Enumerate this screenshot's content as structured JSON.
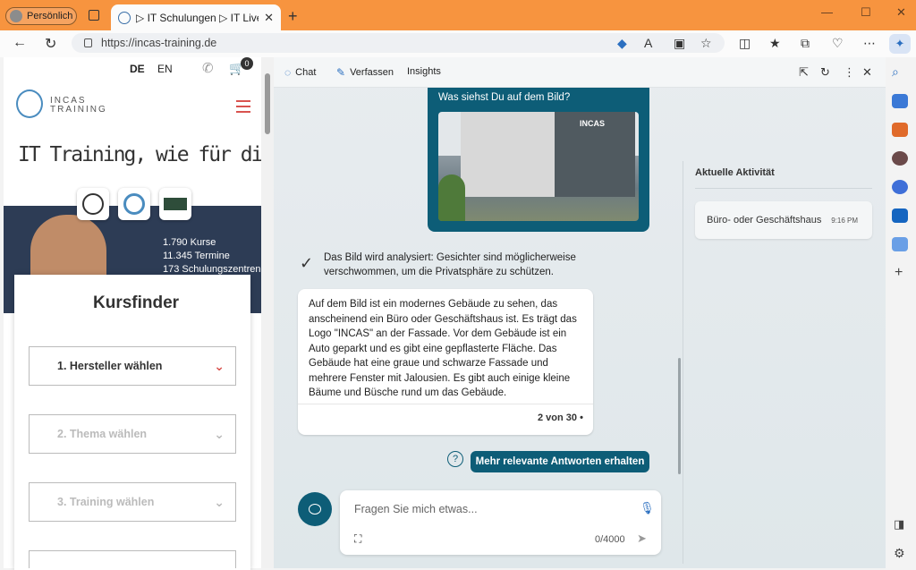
{
  "browser": {
    "profile": "Persönlich",
    "tab_title": "▷ IT Schulungen ▷ IT Live Onlin",
    "new_tab": "+",
    "window_controls": [
      "—",
      "☐",
      "✕"
    ],
    "url": "https://incas-training.de",
    "nav_icons": [
      "back-icon",
      "refresh-icon"
    ],
    "toolbar_icons": [
      "tag-icon",
      "read-aloud-icon",
      "immersive-reader-icon",
      "favorite-star-icon",
      "split-screen-icon",
      "favorites-icon",
      "collections-icon",
      "browser-essentials-icon",
      "more-icon",
      "copilot-icon"
    ]
  },
  "site": {
    "lang_de": "DE",
    "lang_en": "EN",
    "cart_count": "0",
    "logo_text": "INCAS TRAINING",
    "slogan": "IT Training, wie für dich gemacht.",
    "stats": [
      "1.790 Kurse",
      "11.345 Termine",
      "173 Schulungszentren"
    ],
    "kursfinder_title": "Kursfinder",
    "selects": [
      "1. Hersteller wählen",
      "2. Thema wählen",
      "3. Training wählen"
    ],
    "select_colors": {
      "active": "#333333",
      "inactive": "#bbbbbb",
      "accent": "#d9534f"
    }
  },
  "copilot": {
    "tabs": [
      "Chat",
      "Verfassen",
      "Insights"
    ],
    "user_question": "Was siehst Du auf dem Bild?",
    "photo_logo": "INCAS",
    "analysis_note": "Das Bild wird analysiert: Gesichter sind möglicherweise verschwommen, um die Privatsphäre zu schützen.",
    "answer": "Auf dem Bild ist ein modernes Gebäude zu sehen, das anscheinend ein Büro oder Geschäftshaus ist. Es trägt das Logo \"INCAS\" an der Fassade. Vor dem Gebäude ist ein Auto geparkt und es gibt eine gepflasterte Fläche. Das Gebäude hat eine graue und schwarze Fassade und mehrere Fenster mit Jalousien. Es gibt auch einige kleine Bäume und Büsche rund um das Gebäude.",
    "counter": "2 von 30",
    "more_button": "Mehr relevante Antworten erhalten",
    "input_placeholder": "Fragen Sie mich etwas...",
    "char_count": "0/4000",
    "activity_title": "Aktuelle Aktivität",
    "activity_item": "Büro- oder Geschäftshaus",
    "activity_time": "9:16 PM",
    "accent_color": "#0d5d77"
  }
}
